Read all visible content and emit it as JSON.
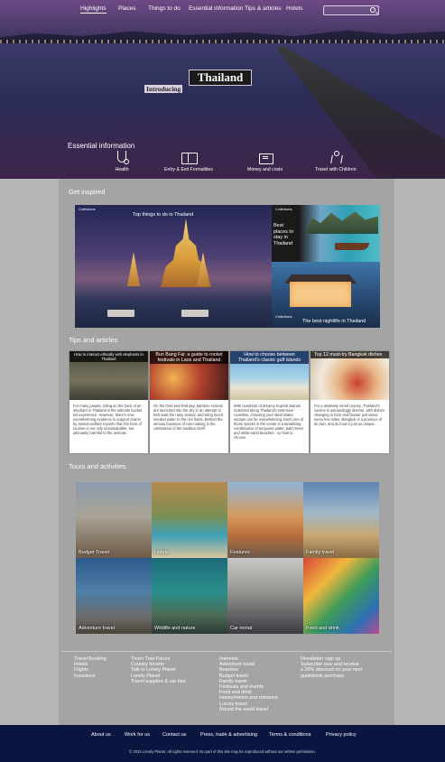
{
  "nav": {
    "items": [
      "Highlights",
      "Places",
      "Things to do",
      "Essential information",
      "Tips & articles",
      "Hotels"
    ],
    "active": "Highlights"
  },
  "hero": {
    "title": "Thailand",
    "subtitle": "Introducing"
  },
  "essential": {
    "title": "Essential information",
    "items": [
      {
        "label": "Health",
        "icon": "health-icon"
      },
      {
        "label": "Entry & Exit Formalities",
        "icon": "passport-icon"
      },
      {
        "label": "Money and costs",
        "icon": "wallet-icon"
      },
      {
        "label": "Travel with Children",
        "icon": "child-icon"
      }
    ]
  },
  "inspire": {
    "title": "Get inspired",
    "tiles": [
      {
        "tag": "Collections",
        "caption": "Top things to do in Thailand"
      },
      {
        "tag": "Collections",
        "caption": "Best places to stay in Thailand"
      },
      {
        "tag": "Collections",
        "caption": "The best nightlife in Thailand"
      }
    ]
  },
  "tips": {
    "title": "Tips and articles",
    "cards": [
      {
        "title": "How to interact ethically with elephants in Thailand",
        "body": "For many people, riding on the back of an elephant in Thailand is the ultimate bucket list experience. However, there's now overwhelming evidence to support claims by animal welfare experts that this form of tourism is not only unsustainable, but ultimately harmful to the animals."
      },
      {
        "title": "Bun Bang Fai: a guide to rocket festivals in Laos and Thailand",
        "body": "On the third and final day, bamboo rockets are launched into the sky in an attempt to kick-start the rainy season and bring much needed water to the rice fields. Behind the serious business of rain-making is the celebration of the tradition itself."
      },
      {
        "title": "How to choose between Thailand's classic gulf islands",
        "body": "With hundreds of dreamy tropical islands scattered along Thailand's extensive coastline, choosing your ideal island escape can be overwhelming. Each one of those specks in the ocean is a tantalising combination of turquoise water, palm trees and white-sand beaches - so how to choose."
      },
      {
        "title": "Top 12 must-try Bangkok dishes",
        "body": "For a relatively small country, Thailand's cuisine is astoundingly diverse, with dishes changing in form and flavour just about every few miles. Bangkok is a province of its own, and its food is just as unique."
      }
    ]
  },
  "tours": {
    "title": "Tours and activities",
    "items": [
      "Budget Travel",
      "Hotels",
      "Features",
      "Family travel",
      "Adventure travel",
      "Wildlife and nature",
      "Car rental",
      "Food and drink"
    ]
  },
  "footer_links": {
    "col1": [
      "Travel Booking",
      "Hotels",
      "Flights",
      "Insurance"
    ],
    "col2": [
      "Thorn Tree Forum",
      "Country forums",
      "Talk to Lonely Planet",
      "Lonely Planet",
      "Travel supplies & car hire"
    ],
    "col3": [
      "Interests",
      "Adventure travel",
      "Beaches",
      "Budget travel",
      "Family travel",
      "Festivals and events",
      "Food and drink",
      "Honeymoons and romance",
      "Luxury travel",
      "Round the world travel"
    ],
    "col4": [
      "Newsletter sign up",
      "Subscribe now and receive",
      "a 20% discount on your next",
      "guidebook purchase"
    ]
  },
  "footer": {
    "links": [
      "About us",
      "Work for us",
      "Contact us",
      "Press, trade & advertising",
      "Terms & conditions",
      "Privacy policy"
    ],
    "copyright": "© 2015 Lonely Planet. All rights reserved. No part of this site may be reproduced without our written permission."
  }
}
